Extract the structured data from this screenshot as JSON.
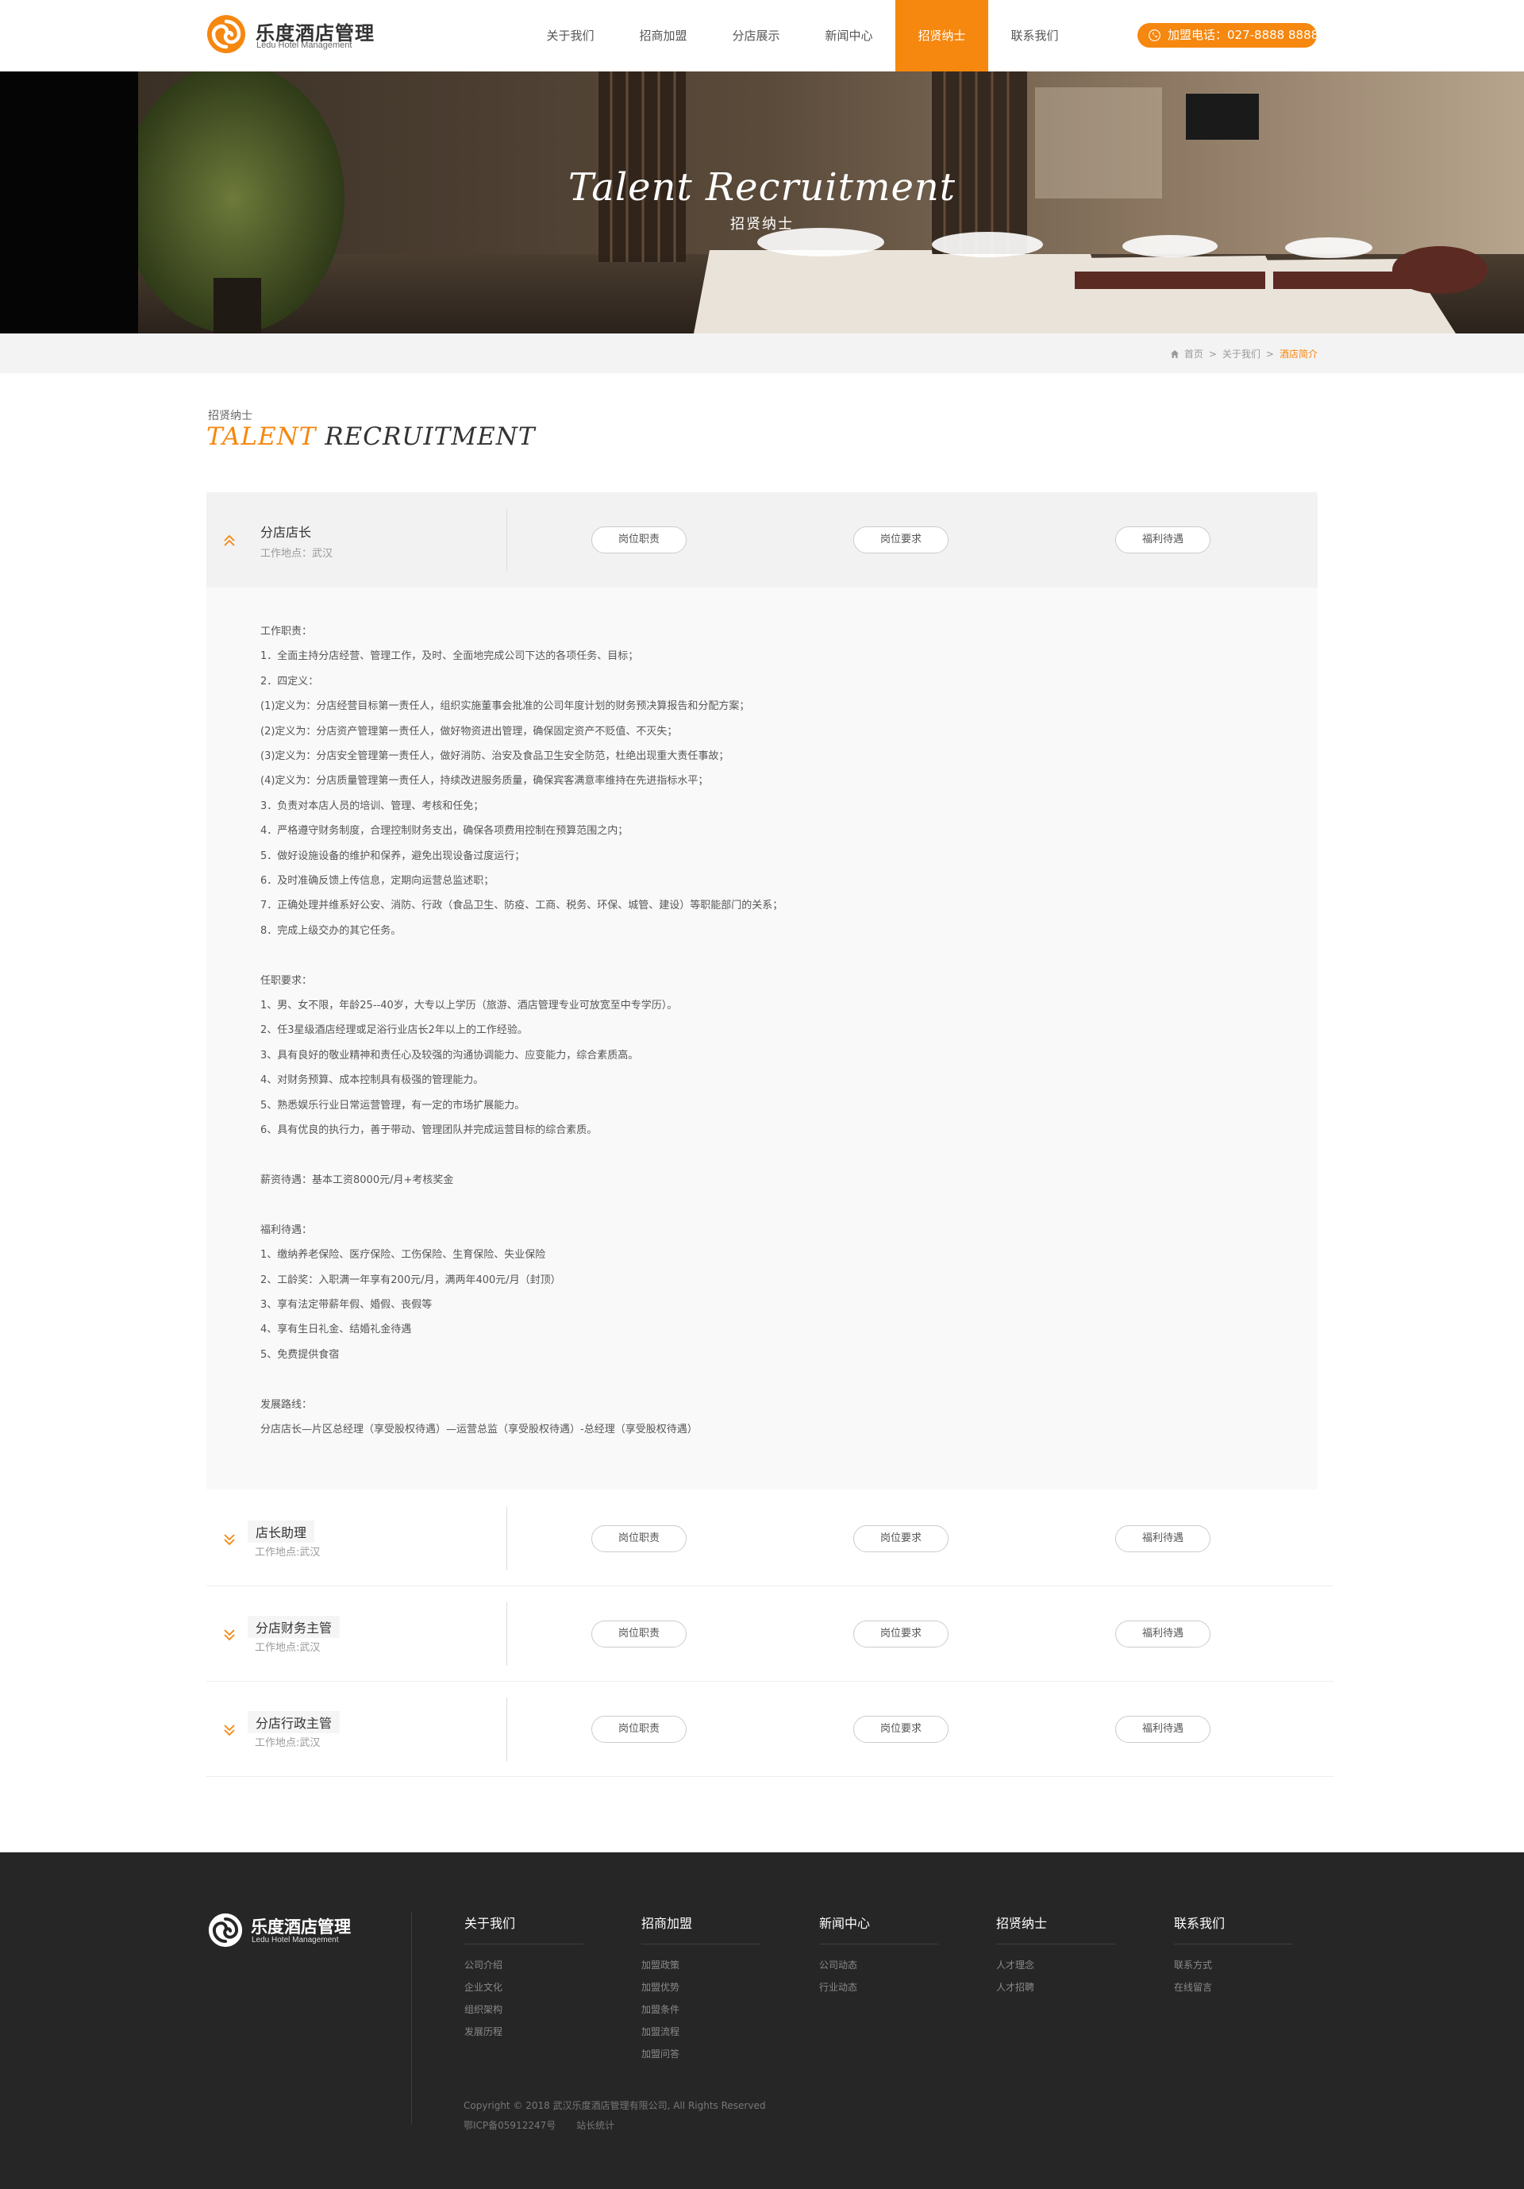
{
  "brand": {
    "name_cn": "乐度酒店管理",
    "name_en": "Ledu Hotel Management",
    "accent_color": "#f6870f",
    "logo_icon": "swirl-logo-icon"
  },
  "nav": {
    "items": [
      {
        "label": "关于我们",
        "active": false
      },
      {
        "label": "招商加盟",
        "active": false
      },
      {
        "label": "分店展示",
        "active": false
      },
      {
        "label": "新闻中心",
        "active": false
      },
      {
        "label": "招贤纳士",
        "active": true
      },
      {
        "label": "联系我们",
        "active": false
      }
    ],
    "hotline": "加盟电话：027-8888 8888",
    "hotline_icon": "phone-icon"
  },
  "banner": {
    "title": "Talent Recruitment",
    "subtitle": "招贤纳士"
  },
  "breadcrumb": {
    "icon": "home-icon",
    "items": [
      "首页",
      "关于我们",
      "酒店简介"
    ],
    "separator": ">"
  },
  "section": {
    "title_cn": "招贤纳士",
    "title_en_1": "TALENT",
    "title_en_2": "RECRUITMENT"
  },
  "jobs": [
    {
      "title": "分店店长",
      "location": "工作地点：武汉",
      "expanded": true,
      "buttons": [
        "岗位职责",
        "岗位要求",
        "福利待遇"
      ],
      "details": [
        "工作职责：",
        "1．全面主持分店经营、管理工作，及时、全面地完成公司下达的各项任务、目标；",
        "2．四定义：",
        "(1)定义为：分店经营目标第一责任人，组织实施董事会批准的公司年度计划的财务预决算报告和分配方案；",
        "(2)定义为：分店资产管理第一责任人，做好物资进出管理，确保固定资产不贬值、不灭失；",
        "(3)定义为：分店安全管理第一责任人，做好消防、治安及食品卫生安全防范，杜绝出现重大责任事故；",
        "(4)定义为：分店质量管理第一责任人，持续改进服务质量，确保宾客满意率维持在先进指标水平；",
        "3．负责对本店人员的培训、管理、考核和任免；",
        "4．严格遵守财务制度，合理控制财务支出，确保各项费用控制在预算范围之内；",
        "5．做好设施设备的维护和保养，避免出现设备过度运行；",
        "6．及时准确反馈上传信息，定期向运营总监述职；",
        "7．正确处理并维系好公安、消防、行政（食品卫生、防疫、工商、税务、环保、城管、建设）等职能部门的关系；",
        "8．完成上级交办的其它任务。",
        "",
        "任职要求：",
        "1、男、女不限，年龄25--40岁，大专以上学历（旅游、酒店管理专业可放宽至中专学历）。",
        "2、任3星级酒店经理或足浴行业店长2年以上的工作经验。",
        "3、具有良好的敬业精神和责任心及较强的沟通协调能力、应变能力，综合素质高。",
        "4、对财务预算、成本控制具有极强的管理能力。",
        "5、熟悉娱乐行业日常运营管理，有一定的市场扩展能力。",
        "6、具有优良的执行力，善于带动、管理团队并完成运营目标的综合素质。",
        "",
        "薪资待遇：基本工资8000元/月+考核奖金",
        "",
        "福利待遇：",
        "1、缴纳养老保险、医疗保险、工伤保险、生育保险、失业保险",
        "2、工龄奖：入职满一年享有200元/月，满两年400元/月（封顶）",
        "3、享有法定带薪年假、婚假、丧假等",
        "4、享有生日礼金、结婚礼金待遇",
        "5、免费提供食宿",
        "",
        "发展路线：",
        "分店店长—片区总经理（享受股权待遇）—运营总监（享受股权待遇）-总经理（享受股权待遇）"
      ]
    },
    {
      "title": "店长助理",
      "location": "工作地点:武汉",
      "expanded": false,
      "buttons": [
        "岗位职责",
        "岗位要求",
        "福利待遇"
      ]
    },
    {
      "title": "分店财务主管",
      "location": "工作地点:武汉",
      "expanded": false,
      "buttons": [
        "岗位职责",
        "岗位要求",
        "福利待遇"
      ]
    },
    {
      "title": "分店行政主管",
      "location": "工作地点:武汉",
      "expanded": false,
      "buttons": [
        "岗位职责",
        "岗位要求",
        "福利待遇"
      ]
    }
  ],
  "footer": {
    "columns": [
      {
        "title": "关于我们",
        "links": [
          "公司介绍",
          "企业文化",
          "组织架构",
          "发展历程"
        ]
      },
      {
        "title": "招商加盟",
        "links": [
          "加盟政策",
          "加盟优势",
          "加盟条件",
          "加盟流程",
          "加盟问答"
        ]
      },
      {
        "title": "新闻中心",
        "links": [
          "公司动态",
          "行业动态"
        ]
      },
      {
        "title": "招贤纳士",
        "links": [
          "人才理念",
          "人才招聘"
        ]
      },
      {
        "title": "联系我们",
        "links": [
          "联系方式",
          "在线留言"
        ]
      }
    ],
    "copyright": "Copyright © 2018 武汉乐度酒店管理有限公司, All Rights Reserved",
    "icp": "鄂ICP备05912247号",
    "stats": "站长统计"
  }
}
